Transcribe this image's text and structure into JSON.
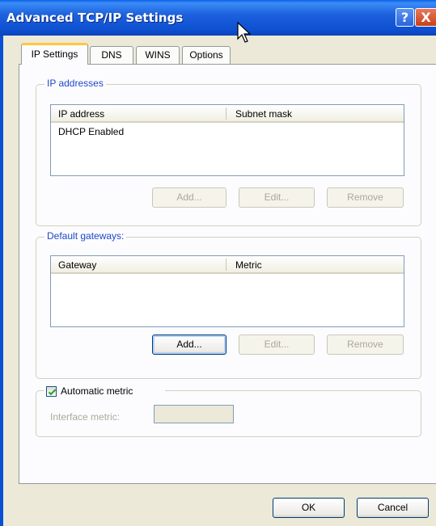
{
  "window": {
    "title": "Advanced TCP/IP Settings",
    "help_glyph": "?",
    "close_glyph": "X"
  },
  "tabs": [
    {
      "label": "IP Settings",
      "active": true
    },
    {
      "label": "DNS",
      "active": false
    },
    {
      "label": "WINS",
      "active": false
    },
    {
      "label": "Options",
      "active": false
    }
  ],
  "ip_addresses": {
    "legend": "IP addresses",
    "columns": [
      "IP address",
      "Subnet mask"
    ],
    "rows": [
      "DHCP Enabled"
    ],
    "add_label": "Add...",
    "edit_label": "Edit...",
    "remove_label": "Remove"
  },
  "default_gateways": {
    "legend": "Default gateways:",
    "columns": [
      "Gateway",
      "Metric"
    ],
    "add_label": "Add...",
    "edit_label": "Edit...",
    "remove_label": "Remove"
  },
  "metric": {
    "automatic_label": "Automatic metric",
    "automatic_checked": true,
    "interface_label": "Interface metric:",
    "interface_value": ""
  },
  "footer": {
    "ok_label": "OK",
    "cancel_label": "Cancel"
  },
  "colors": {
    "titlebar": "#0d4fd0",
    "dialog_bg": "#ece9d8",
    "legend_text": "#1e48c8",
    "tab_highlight": "#ffc73c"
  }
}
